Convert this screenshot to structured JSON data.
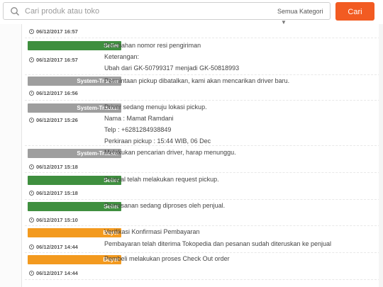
{
  "search": {
    "placeholder": "Cari produk atau toko",
    "category": "Semua Kategori",
    "button": "Cari"
  },
  "colors": {
    "seller": "#3f8f3f",
    "tracker": "#9e9e9e",
    "buyer": "#f39a1f",
    "cari": "#f25b22"
  },
  "timeline": [
    {
      "ts": "06/12/2017 16:57"
    },
    {
      "badge": "Seller",
      "ts": "06/12/2017 16:57",
      "lines": [
        "Perubahan nomor resi pengiriman",
        "Keterangan:",
        "Ubah dari GK-50799317 menjadi GK-50818993"
      ]
    },
    {
      "badge": "System-Tracker",
      "ts": "06/12/2017 16:56",
      "lines": [
        "Permintaan pickup dibatalkan, kami akan mencarikan driver baru."
      ]
    },
    {
      "badge": "System-Tracker",
      "ts": "06/12/2017 15:26",
      "lines": [
        "Driver sedang menuju lokasi pickup.",
        "Nama : Mamat Ramdani",
        "Telp : +6281284938849",
        "Perkiraan pickup : 15:44 WIB, 06 Dec"
      ]
    },
    {
      "badge": "System-Tracker",
      "ts": "06/12/2017 15:18",
      "lines": [
        "Melakukan pencarian driver, harap menunggu."
      ]
    },
    {
      "badge": "Seller",
      "ts": "06/12/2017 15:18",
      "lines": [
        "Penjual telah melakukan request pickup."
      ]
    },
    {
      "badge": "Seller",
      "ts": "06/12/2017 15:10",
      "lines": [
        "Pemesanan sedang diproses oleh penjual."
      ]
    },
    {
      "badge": "Buyer",
      "ts": "06/12/2017 14:44",
      "lines": [
        "Verifikasi Konfirmasi Pembayaran",
        "Pembayaran telah diterima Tokopedia dan pesanan sudah diteruskan ke penjual"
      ]
    },
    {
      "badge": "Buyer",
      "ts": "06/12/2017 14:44",
      "lines": [
        "Pembeli melakukan proses Check Out order"
      ]
    }
  ]
}
